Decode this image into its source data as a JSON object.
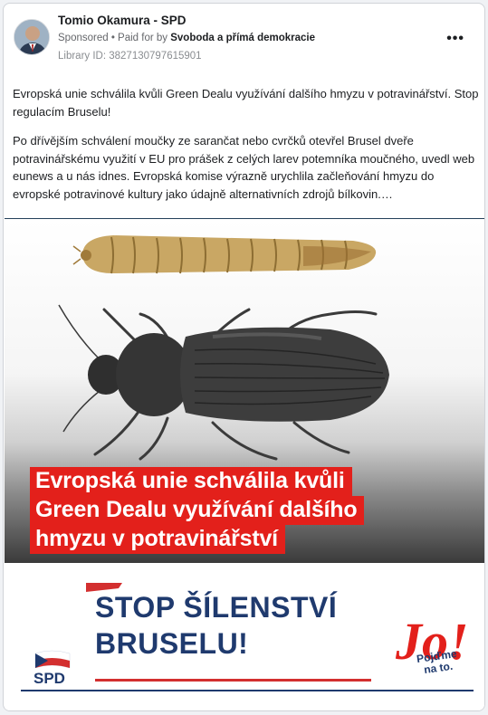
{
  "post": {
    "page_name": "Tomio Okamura - SPD",
    "sponsored": "Sponsored",
    "paid_prefix": "• Paid for by",
    "payer": "Svoboda a přímá demokracie",
    "library_id": "Library ID: 3827130797615901",
    "more_icon": "more-dots-icon",
    "text_p1": "Evropská unie schválila kvůli Green Dealu využívání dalšího hmyzu v potravinářství. Stop regulacím Bruselu!",
    "text_p2": "Po dřívějším schválení moučky ze sarančat nebo cvrčků otevřel Brusel dveře potravinářskému využití v EU pro prášek z celých larev potemníka moučného, uvedl web eunews a u nás idnes. Evropská komise výrazně urychlila začleňování hmyzu do evropské potravinové kultury jako údajně alternativních zdrojů bílkovin.…"
  },
  "creative": {
    "headline_1": "Evropská unie schválila kvůli",
    "headline_2": "Green Dealu využívání dalšího",
    "headline_3": "hmyzu v potravinářství",
    "slogan_1": "STOP ŠÍLENSTVÍ",
    "slogan_2": "BRUSELU!",
    "spd_label": "SPD",
    "jo_text": "Jo!",
    "jo_tag_1": "Pojďme",
    "jo_tag_2": "na to.",
    "colors": {
      "headline_bg": "#e3201b",
      "brand_blue": "#1f3a6e",
      "brand_red": "#d32f2f"
    }
  }
}
